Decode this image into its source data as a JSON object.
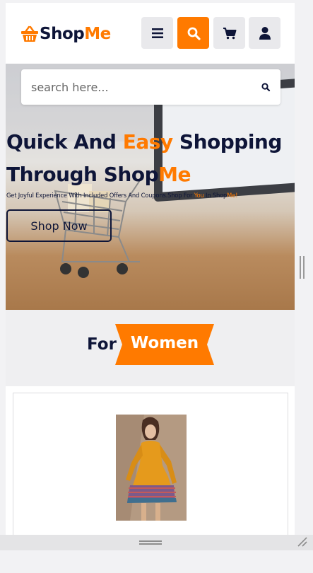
{
  "brand": {
    "name_main": "Shop",
    "name_accent": "Me",
    "accent_color": "#ff7a00",
    "dark_color": "#0e1538"
  },
  "header": {
    "buttons": [
      {
        "name": "menu-icon"
      },
      {
        "name": "search-icon"
      },
      {
        "name": "cart-icon"
      },
      {
        "name": "user-icon"
      }
    ]
  },
  "search": {
    "placeholder": "search here..."
  },
  "hero": {
    "title_part1": "Quick And ",
    "title_accent": "Easy",
    "title_part2": " Shopping Through Shop",
    "title_accent2": "Me",
    "subtitle_part1": "Get Joyful Experience With Included Offers And Coupons.Shop For ",
    "subtitle_accent1": "You",
    "subtitle_part2": " In Shop",
    "subtitle_accent2": "Me!",
    "cta_label": "Shop Now"
  },
  "section": {
    "prefix": "For",
    "label": "Women"
  }
}
